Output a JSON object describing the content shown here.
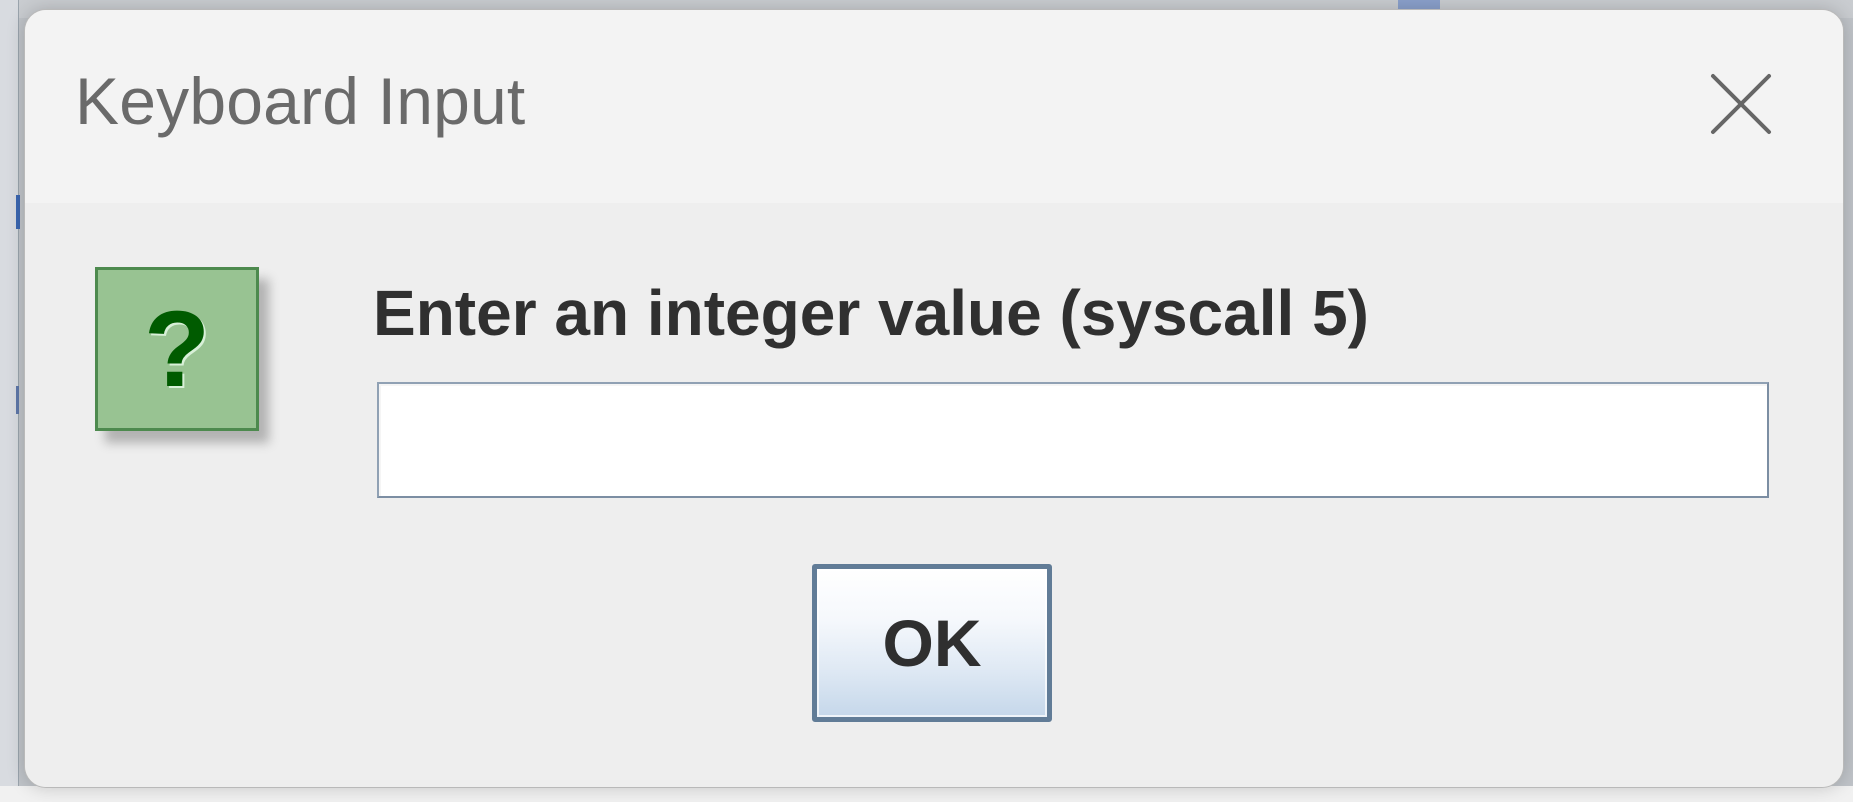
{
  "dialog": {
    "title": "Keyboard Input",
    "close_icon": "close-icon",
    "prompt": "Enter an integer value (syscall 5)",
    "input_value": "",
    "ok_label": "OK",
    "icon": "question-icon"
  },
  "colors": {
    "dialog_background": "#eeeeee",
    "titlebar_background": "#f3f3f3",
    "icon_fill": "#98c392",
    "icon_glyph": "#005b00",
    "button_border": "#617c97"
  }
}
